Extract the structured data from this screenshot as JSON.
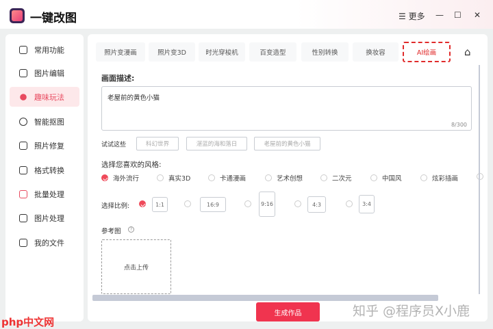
{
  "app": {
    "title": "一键改图",
    "more": "更多",
    "minimize": "—",
    "maximize": "☐",
    "close": "✕"
  },
  "sidebar": {
    "items": [
      {
        "label": "常用功能",
        "icon": "apps-icon"
      },
      {
        "label": "图片编辑",
        "icon": "edit-icon"
      },
      {
        "label": "趣味玩法",
        "icon": "magic-icon",
        "active": true
      },
      {
        "label": "智能抠图",
        "icon": "cutout-icon"
      },
      {
        "label": "照片修复",
        "icon": "repair-icon"
      },
      {
        "label": "格式转换",
        "icon": "convert-icon"
      },
      {
        "label": "批量处理",
        "icon": "layers-icon"
      },
      {
        "label": "图片处理",
        "icon": "image-icon"
      },
      {
        "label": "我的文件",
        "icon": "file-icon"
      }
    ]
  },
  "tabs": [
    "照片变漫画",
    "照片变3D",
    "时光穿梭机",
    "百变造型",
    "性别转换",
    "换妆容",
    "AI绘画"
  ],
  "form": {
    "desc_label": "画面描述:",
    "desc_value": "老屋前的黄色小猫",
    "count": "8/300",
    "try_label": "试试这些",
    "suggestions": [
      "科幻世界",
      "湛蓝的海和落日",
      "老屋前的黄色小猫"
    ],
    "style_label": "选择您喜欢的风格:",
    "styles": [
      "海外流行",
      "真实3D",
      "卡通漫画",
      "艺术创想",
      "二次元",
      "中国风",
      "炫彩插画"
    ],
    "ratio_label": "选择比例:",
    "ratios": [
      "1:1",
      "16:9",
      "9:16",
      "4:3",
      "3:4"
    ],
    "ref_label": "参考图",
    "ref_help": "?",
    "upload": "点击上传",
    "generate": "生成作品"
  },
  "watermarks": {
    "left": "php中文网",
    "right": "知乎 @程序员X小鹿"
  },
  "colors": {
    "accent": "#f0344f",
    "active_bg": "#fde8ea"
  }
}
